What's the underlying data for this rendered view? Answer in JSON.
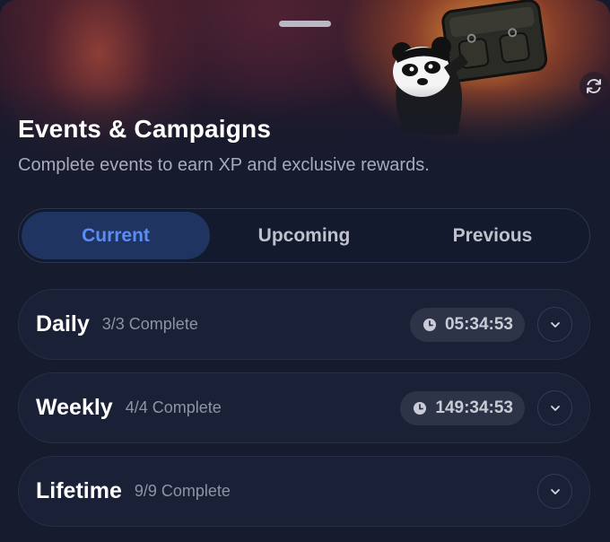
{
  "header": {
    "title": "Events & Campaigns",
    "subtitle": "Complete events to earn XP and exclusive rewards."
  },
  "tabs": [
    {
      "label": "Current",
      "active": true
    },
    {
      "label": "Upcoming",
      "active": false
    },
    {
      "label": "Previous",
      "active": false
    }
  ],
  "events": [
    {
      "name": "Daily",
      "status": "3/3 Complete",
      "timer": "05:34:53",
      "icon": "clock-icon"
    },
    {
      "name": "Weekly",
      "status": "4/4 Complete",
      "timer": "149:34:53",
      "icon": "clock-icon"
    },
    {
      "name": "Lifetime",
      "status": "9/9 Complete"
    }
  ],
  "colors": {
    "accent": "#5b8cf4",
    "active_tab_bg": "#1f3460",
    "background": "#161b2d"
  }
}
